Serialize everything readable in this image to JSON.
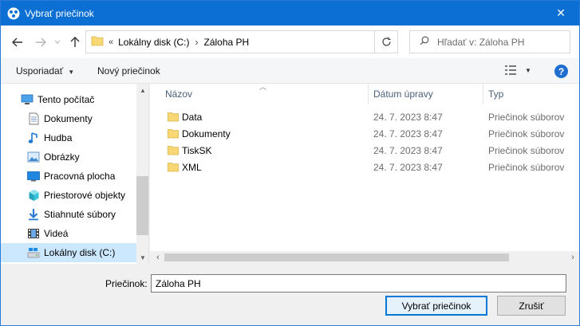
{
  "window": {
    "title": "Vybrať priečinok",
    "close_glyph": "✕"
  },
  "address": {
    "overflow": "«",
    "crumbs": [
      "Lokálny disk (C:)",
      "Záloha PH"
    ],
    "separator": "›",
    "search_placeholder": "Hľadať v: Záloha PH"
  },
  "toolbar": {
    "organize_label": "Usporiadať",
    "new_folder_label": "Nový priečinok",
    "help_label": "?"
  },
  "sidebar": {
    "items": [
      {
        "label": "Tento počítač",
        "icon": "pc-icon"
      },
      {
        "label": "Dokumenty",
        "icon": "documents-icon"
      },
      {
        "label": "Hudba",
        "icon": "music-icon"
      },
      {
        "label": "Obrázky",
        "icon": "pictures-icon"
      },
      {
        "label": "Pracovná plocha",
        "icon": "desktop-icon"
      },
      {
        "label": "Priestorové objekty",
        "icon": "3d-objects-icon"
      },
      {
        "label": "Stiahnuté súbory",
        "icon": "downloads-icon"
      },
      {
        "label": "Videá",
        "icon": "videos-icon"
      },
      {
        "label": "Lokálny disk (C:)",
        "icon": "drive-icon",
        "selected": true
      }
    ]
  },
  "files": {
    "columns": [
      "Názov",
      "Dátum úpravy",
      "Typ"
    ],
    "rows": [
      {
        "name": "Data",
        "date": "24. 7. 2023 8:47",
        "type": "Priečinok súborov"
      },
      {
        "name": "Dokumenty",
        "date": "24. 7. 2023 8:47",
        "type": "Priečinok súborov"
      },
      {
        "name": "TiskSK",
        "date": "24. 7. 2023 8:47",
        "type": "Priečinok súborov"
      },
      {
        "name": "XML",
        "date": "24. 7. 2023 8:47",
        "type": "Priečinok súborov"
      }
    ]
  },
  "bottom": {
    "folder_label": "Priečinok:",
    "folder_value": "Záloha PH",
    "select_button": "Vybrať priečinok",
    "cancel_button": "Zrušiť"
  },
  "colors": {
    "titlebar": "#0b6fd3",
    "selection": "#cce8ff",
    "folder": "#f8d775"
  }
}
